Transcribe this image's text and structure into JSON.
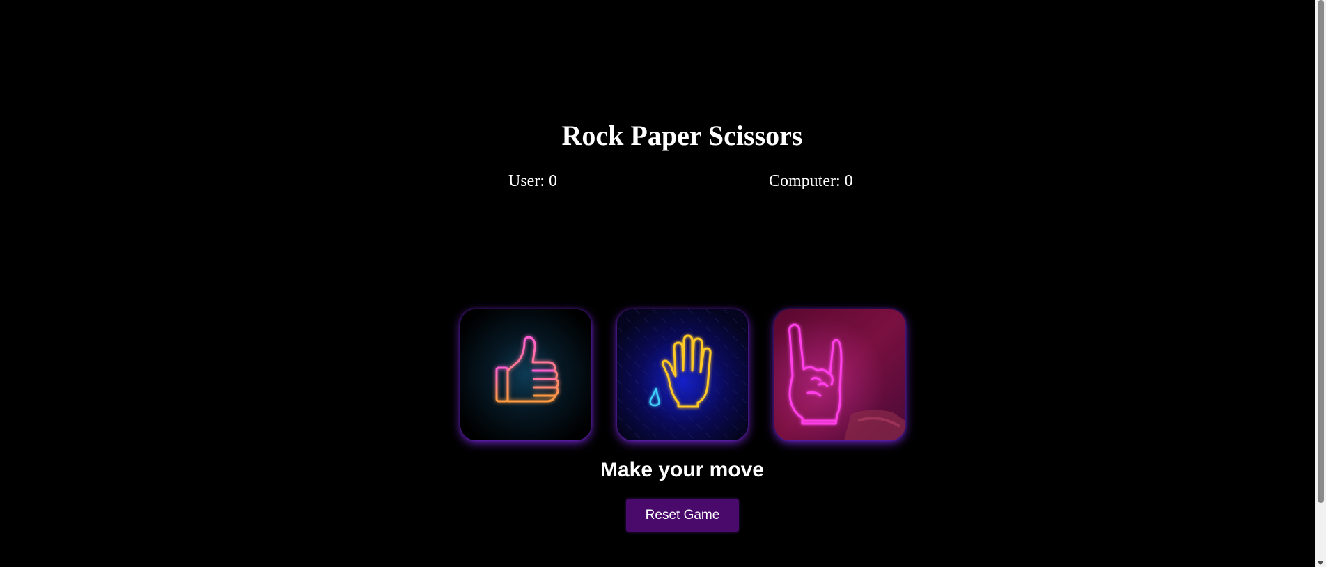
{
  "game": {
    "title": "Rock Paper Scissors",
    "score": {
      "user_label": "User: 0",
      "computer_label": "Computer: 0"
    },
    "choices": [
      {
        "name": "rock",
        "icon": "thumbs-up-neon-icon",
        "accent": "#ff6fb0"
      },
      {
        "name": "paper",
        "icon": "open-hand-neon-icon",
        "accent": "#ffd23f"
      },
      {
        "name": "scissors",
        "icon": "rock-on-hand-neon-icon",
        "accent": "#ff3fe0"
      }
    ],
    "message": "Make your move",
    "reset_label": "Reset Game"
  },
  "colors": {
    "background": "#000000",
    "button": "#4a0a6b",
    "glow": "#7a28dc"
  }
}
